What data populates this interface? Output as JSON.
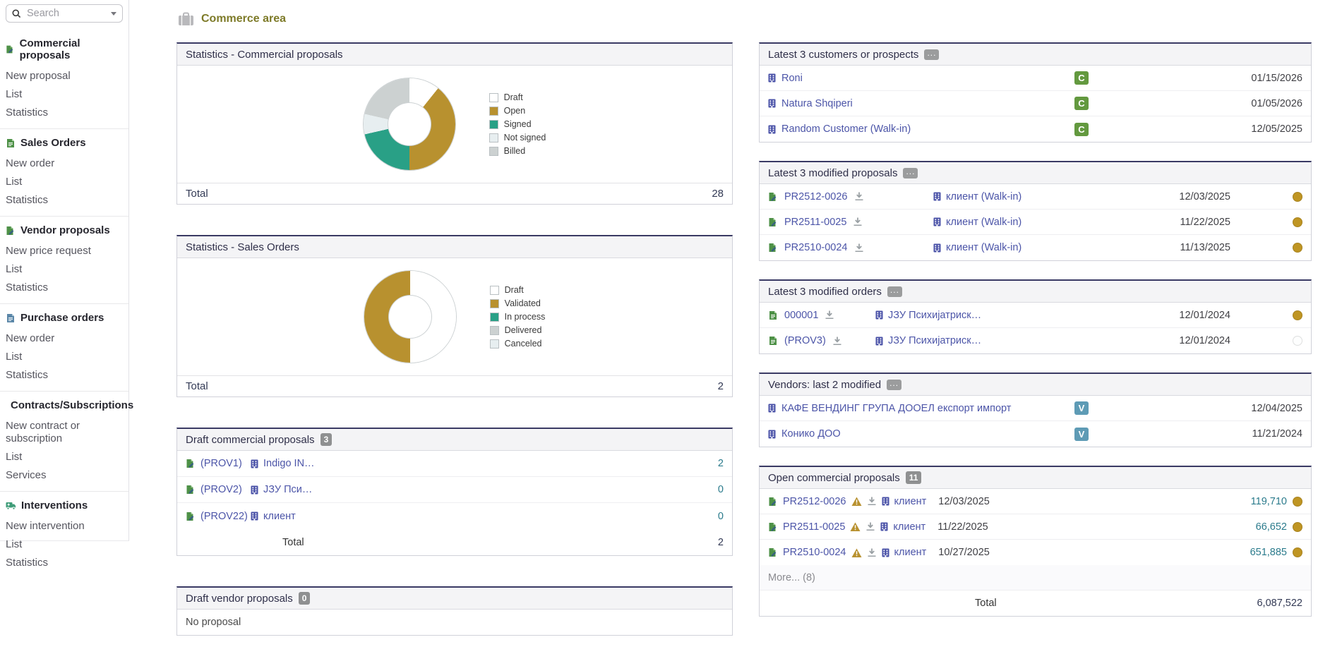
{
  "icons": {
    "ellipsis": "..."
  },
  "sidebar": {
    "search_placeholder": "Search",
    "sections": [
      {
        "title": "Commercial proposals",
        "items": [
          "New proposal",
          "List",
          "Statistics"
        ]
      },
      {
        "title": "Sales Orders",
        "items": [
          "New order",
          "List",
          "Statistics"
        ]
      },
      {
        "title": "Vendor proposals",
        "items": [
          "New price request",
          "List",
          "Statistics"
        ]
      },
      {
        "title": "Purchase orders",
        "items": [
          "New order",
          "List",
          "Statistics"
        ]
      },
      {
        "title": "Contracts/Subscriptions",
        "items": [
          "New contract or subscription",
          "List",
          "Services"
        ]
      },
      {
        "title": "Interventions",
        "items": [
          "New intervention",
          "List",
          "Statistics"
        ]
      }
    ]
  },
  "header": {
    "title": "Commerce area"
  },
  "stats_proposals": {
    "title": "Statistics - Commercial proposals",
    "total_label": "Total",
    "total": "28",
    "donut": {
      "values": [
        3,
        11,
        6,
        2,
        6
      ],
      "colors": [
        "#ffffff",
        "#b8912f",
        "#29a086",
        "#e7eef0",
        "#ccd1d1"
      ]
    },
    "legend": [
      {
        "label": "Draft",
        "color": "#ffffff"
      },
      {
        "label": "Open",
        "color": "#b8912f"
      },
      {
        "label": "Signed",
        "color": "#29a086"
      },
      {
        "label": "Not signed",
        "color": "#e7eef0"
      },
      {
        "label": "Billed",
        "color": "#ccd1d1"
      }
    ]
  },
  "stats_orders": {
    "title": "Statistics - Sales Orders",
    "total_label": "Total",
    "total": "2",
    "donut": {
      "values": [
        1,
        1,
        0,
        0,
        0
      ],
      "colors": [
        "#ffffff",
        "#b8912f",
        "#29a086",
        "#ccd1d1",
        "#e7eef0"
      ]
    },
    "legend": [
      {
        "label": "Draft",
        "color": "#ffffff"
      },
      {
        "label": "Validated",
        "color": "#b8912f"
      },
      {
        "label": "In process",
        "color": "#29a086"
      },
      {
        "label": "Delivered",
        "color": "#ccd1d1"
      },
      {
        "label": "Canceled",
        "color": "#e7eef0"
      }
    ]
  },
  "draft_proposals": {
    "title": "Draft commercial proposals",
    "count": "3",
    "rows": [
      {
        "ref": "(PROV1)",
        "company": "Indigo IN…",
        "value": "2"
      },
      {
        "ref": "(PROV2)",
        "company": "ЈЗУ Пси…",
        "value": "0"
      },
      {
        "ref": "(PROV22)",
        "company": "клиент",
        "value": "0"
      }
    ],
    "total_label": "Total",
    "total": "2"
  },
  "draft_vendor_proposals": {
    "title": "Draft vendor proposals",
    "count": "0",
    "empty": "No proposal"
  },
  "latest_customers": {
    "title": "Latest 3 customers or prospects",
    "rows": [
      {
        "name": "Roni",
        "badge": "C",
        "date": "01/15/2026"
      },
      {
        "name": "Natura Shqiperi",
        "badge": "C",
        "date": "01/05/2026"
      },
      {
        "name": "Random Customer (Walk-in)",
        "badge": "C",
        "date": "12/05/2025"
      }
    ]
  },
  "latest_proposals": {
    "title": "Latest 3 modified proposals",
    "rows": [
      {
        "ref": "PR2512-0026",
        "company": "клиент (Walk-in)",
        "date": "12/03/2025",
        "dot": "#bf9523"
      },
      {
        "ref": "PR2511-0025",
        "company": "клиент (Walk-in)",
        "date": "11/22/2025",
        "dot": "#bf9523"
      },
      {
        "ref": "PR2510-0024",
        "company": "клиент (Walk-in)",
        "date": "11/13/2025",
        "dot": "#bf9523"
      }
    ]
  },
  "latest_orders": {
    "title": "Latest 3 modified orders",
    "rows": [
      {
        "ref": "000001",
        "company": "ЈЗУ Психијатриск…",
        "date": "12/01/2024",
        "dot": "#bf9523"
      },
      {
        "ref": "(PROV3)",
        "company": "ЈЗУ Психијатриск…",
        "date": "12/01/2024",
        "dot": "#fdfefe"
      }
    ]
  },
  "vendors": {
    "title": "Vendors: last 2 modified",
    "rows": [
      {
        "name": "КАФЕ ВЕНДИНГ ГРУПА ДООЕЛ експорт импорт",
        "badge": "V",
        "date": "12/04/2025"
      },
      {
        "name": "Конико ДОО",
        "badge": "V",
        "date": "11/21/2024"
      }
    ]
  },
  "open_proposals": {
    "title": "Open commercial proposals",
    "count": "11",
    "rows": [
      {
        "ref": "PR2512-0026",
        "company": "клиент",
        "date": "12/03/2025",
        "amount": "119,710",
        "dot": "#bf9523"
      },
      {
        "ref": "PR2511-0025",
        "company": "клиент",
        "date": "11/22/2025",
        "amount": "66,652",
        "dot": "#bf9523"
      },
      {
        "ref": "PR2510-0024",
        "company": "клиент",
        "date": "10/27/2025",
        "amount": "651,885",
        "dot": "#bf9523"
      }
    ],
    "more_label": "More... (8)",
    "total_label": "Total",
    "total": "6,087,522"
  }
}
